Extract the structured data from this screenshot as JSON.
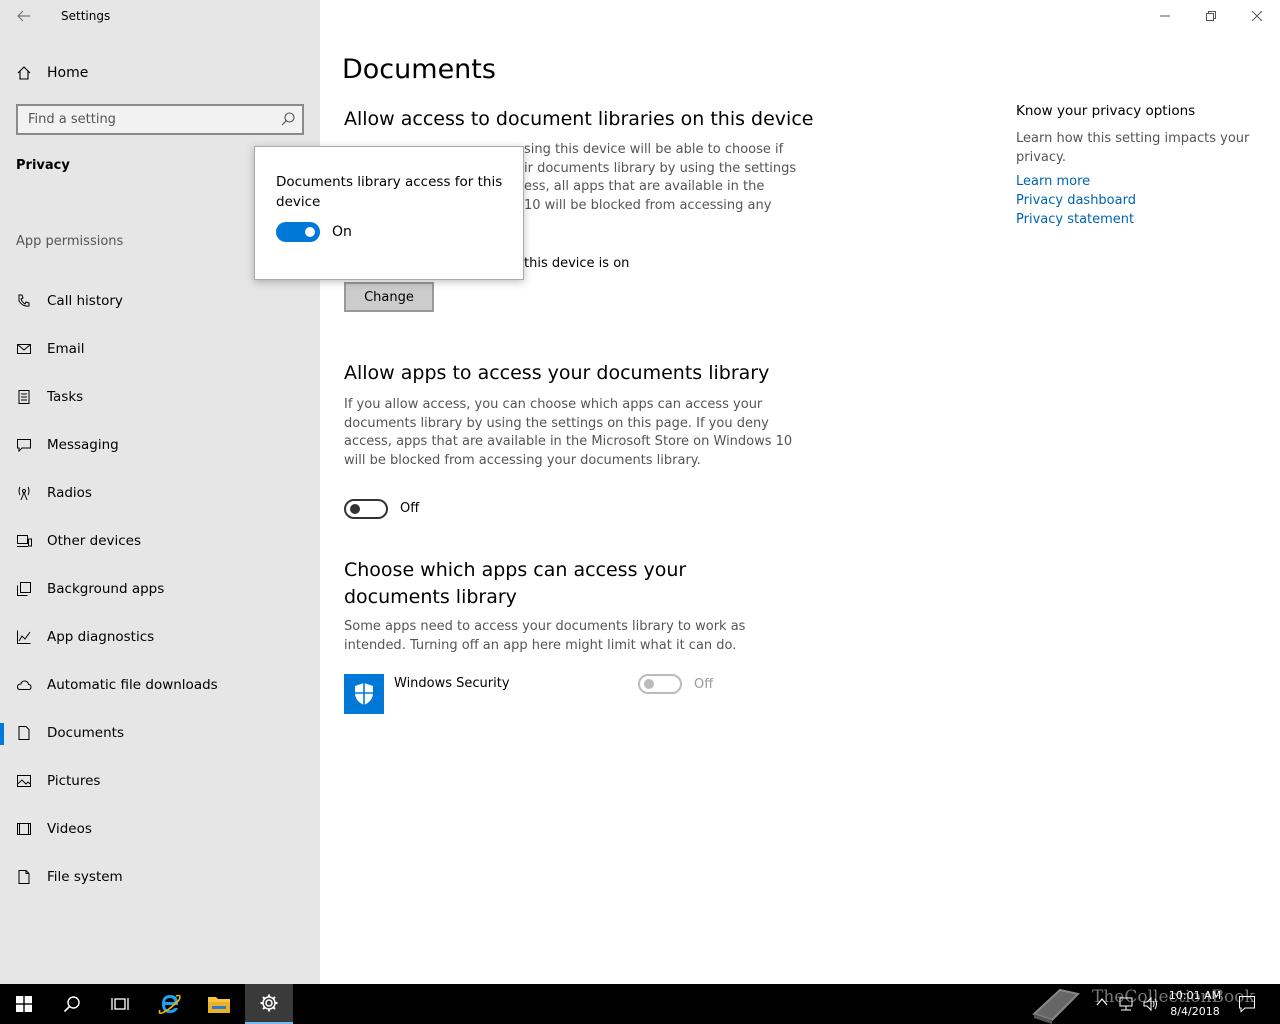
{
  "window": {
    "title": "Settings"
  },
  "sidebar": {
    "home_label": "Home",
    "search_placeholder": "Find a setting",
    "section_title": "Privacy",
    "group_title": "App permissions",
    "items": [
      {
        "label": "Call history",
        "icon": "call-history-icon"
      },
      {
        "label": "Email",
        "icon": "mail-icon"
      },
      {
        "label": "Tasks",
        "icon": "tasks-icon"
      },
      {
        "label": "Messaging",
        "icon": "message-icon"
      },
      {
        "label": "Radios",
        "icon": "radio-antenna-icon"
      },
      {
        "label": "Other devices",
        "icon": "devices-icon"
      },
      {
        "label": "Background apps",
        "icon": "background-apps-icon"
      },
      {
        "label": "App diagnostics",
        "icon": "diagnostics-icon"
      },
      {
        "label": "Automatic file downloads",
        "icon": "cloud-icon"
      },
      {
        "label": "Documents",
        "icon": "document-icon",
        "active": true
      },
      {
        "label": "Pictures",
        "icon": "picture-icon"
      },
      {
        "label": "Videos",
        "icon": "video-icon"
      },
      {
        "label": "File system",
        "icon": "file-icon"
      }
    ]
  },
  "main": {
    "page_title": "Documents",
    "section1": {
      "heading": "Allow access to document libraries on this device",
      "lines": [
        "sing this device will be able to choose if",
        "ir documents library by using the settings",
        "ess, all apps that are available in the",
        "10 will be blocked from accessing any"
      ],
      "status_text": "this device is on",
      "change_label": "Change"
    },
    "section2": {
      "heading": "Allow apps to access your documents library",
      "description": "If you allow access, you can choose which apps can access your documents library by using the settings on this page. If you deny access, apps that are available in the Microsoft Store on Windows 10 will be blocked from accessing your documents library.",
      "toggle_state": "Off"
    },
    "section3": {
      "heading": "Choose which apps can access your documents library",
      "description": "Some apps need to access your documents library to work as intended. Turning off an app here might limit what it can do.",
      "apps": [
        {
          "name": "Windows Security",
          "toggle_state": "Off"
        }
      ]
    }
  },
  "right_column": {
    "title": "Know your privacy options",
    "text": "Learn how this setting impacts your privacy.",
    "links": [
      "Learn more",
      "Privacy dashboard",
      "Privacy statement"
    ]
  },
  "popup": {
    "title": "Documents library access for this device",
    "toggle_state": "On"
  },
  "taskbar": {
    "watermark": "TheCollectionBook",
    "time": "10:01 AM",
    "date": "8/4/2018"
  },
  "colors": {
    "accent": "#0078d7",
    "sidebar_bg": "#e6e6e6",
    "link": "#0063b1"
  }
}
